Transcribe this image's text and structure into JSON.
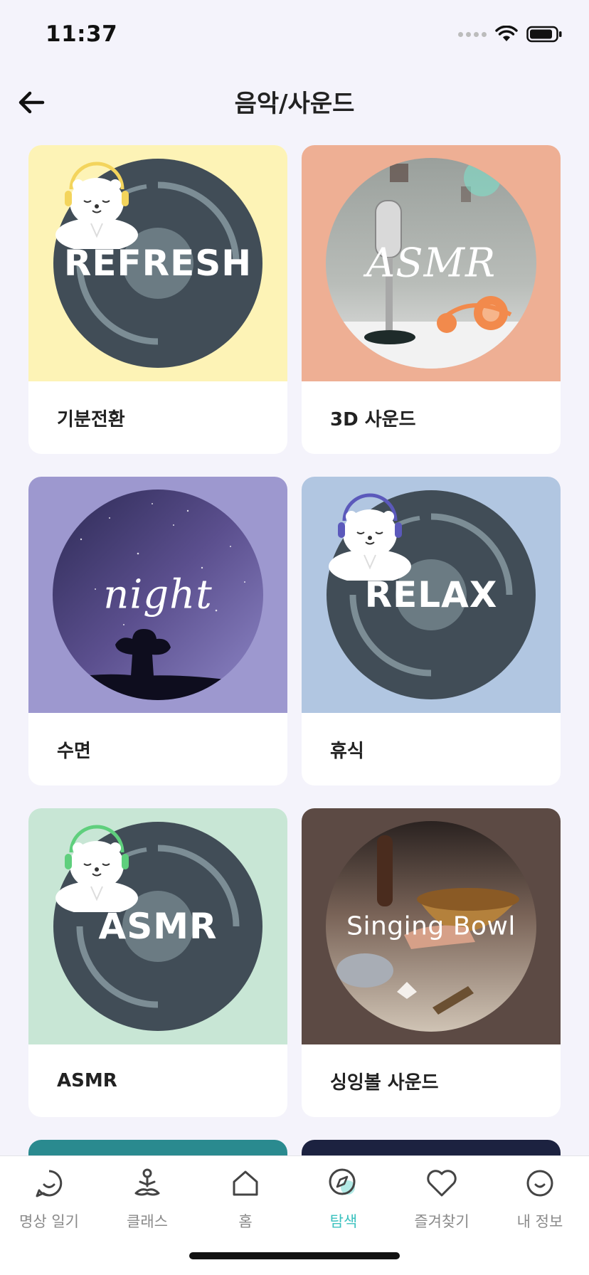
{
  "status_bar": {
    "time": "11:37"
  },
  "header": {
    "title": "음악/사운드"
  },
  "colors": {
    "accent": "#3cc2bf",
    "background": "#f4f3fb",
    "disc": "#414d57",
    "disc_ring": "#7c8d95"
  },
  "cards": [
    {
      "label": "기분전환",
      "art_text": "REFRESH",
      "bg": "#fdf3b6",
      "headphone": "#f3d45c",
      "icon": "refresh-disc-art"
    },
    {
      "label": "3D 사운드",
      "art_text": "ASMR",
      "bg": "#eeaf94",
      "icon": "asmr-microphone-art"
    },
    {
      "label": "수면",
      "art_text": "night",
      "bg": "#9d98cf",
      "icon": "night-sky-art"
    },
    {
      "label": "휴식",
      "art_text": "RELAX",
      "bg": "#b1c6e1",
      "headphone": "#5b59bb",
      "icon": "relax-disc-art"
    },
    {
      "label": "ASMR",
      "art_text": "ASMR",
      "bg": "#c8e6d5",
      "headphone": "#5fcf7d",
      "icon": "asmr-disc-art"
    },
    {
      "label": "싱잉볼 사운드",
      "art_text": "Singing Bowl",
      "bg": "#5c4a44",
      "icon": "singing-bowl-art"
    }
  ],
  "tabs": [
    {
      "label": "명상 일기",
      "icon": "chat-smile-icon",
      "active": false
    },
    {
      "label": "클래스",
      "icon": "meditation-icon",
      "active": false
    },
    {
      "label": "홈",
      "icon": "home-icon",
      "active": false
    },
    {
      "label": "탐색",
      "icon": "compass-icon",
      "active": true
    },
    {
      "label": "즐겨찾기",
      "icon": "heart-icon",
      "active": false
    },
    {
      "label": "내 정보",
      "icon": "smile-icon",
      "active": false
    }
  ]
}
